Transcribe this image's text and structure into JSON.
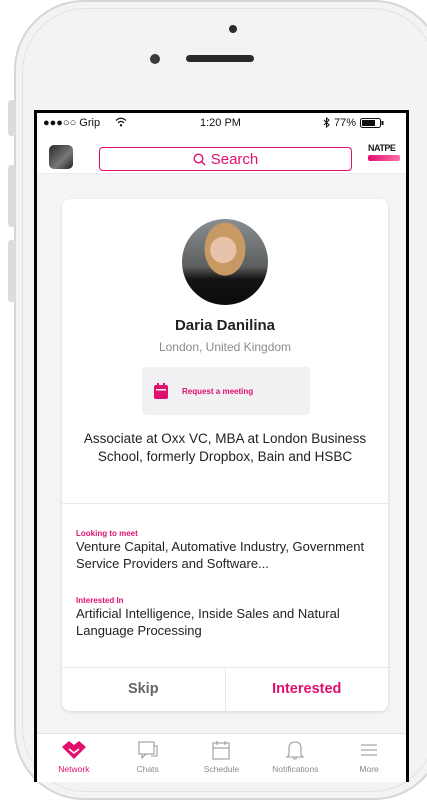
{
  "status_bar": {
    "carrier": "●●●○○ Grip",
    "time": "1:20 PM",
    "battery": "77%"
  },
  "search": {
    "label": "Search"
  },
  "logo": {
    "text": "NATPE"
  },
  "profile": {
    "name": "Daria Danilina",
    "location": "London, United Kingdom",
    "request_meeting_label": "Request a meeting",
    "bio": "Associate at Oxx VC, MBA at London Business School, formerly Dropbox, Bain and HSBC",
    "looking_to_meet": {
      "label": "Looking to meet",
      "text": "Venture Capital, Automative Industry, Government Service Providers and Software..."
    },
    "interested_in": {
      "label": "Interested In",
      "text": "Artificial Intelligence, Inside Sales and Natural Language Processing"
    }
  },
  "actions": {
    "skip": "Skip",
    "interested": "Interested"
  },
  "tabs": [
    {
      "label": "Network",
      "icon": "handshake-icon",
      "active": true
    },
    {
      "label": "Chats",
      "icon": "chat-icon",
      "active": false
    },
    {
      "label": "Schedule",
      "icon": "calendar-icon",
      "active": false
    },
    {
      "label": "Notifications",
      "icon": "bell-icon",
      "active": false
    },
    {
      "label": "More",
      "icon": "menu-icon",
      "active": false
    }
  ],
  "colors": {
    "accent": "#e0106f",
    "background": "#f4f4f6"
  }
}
